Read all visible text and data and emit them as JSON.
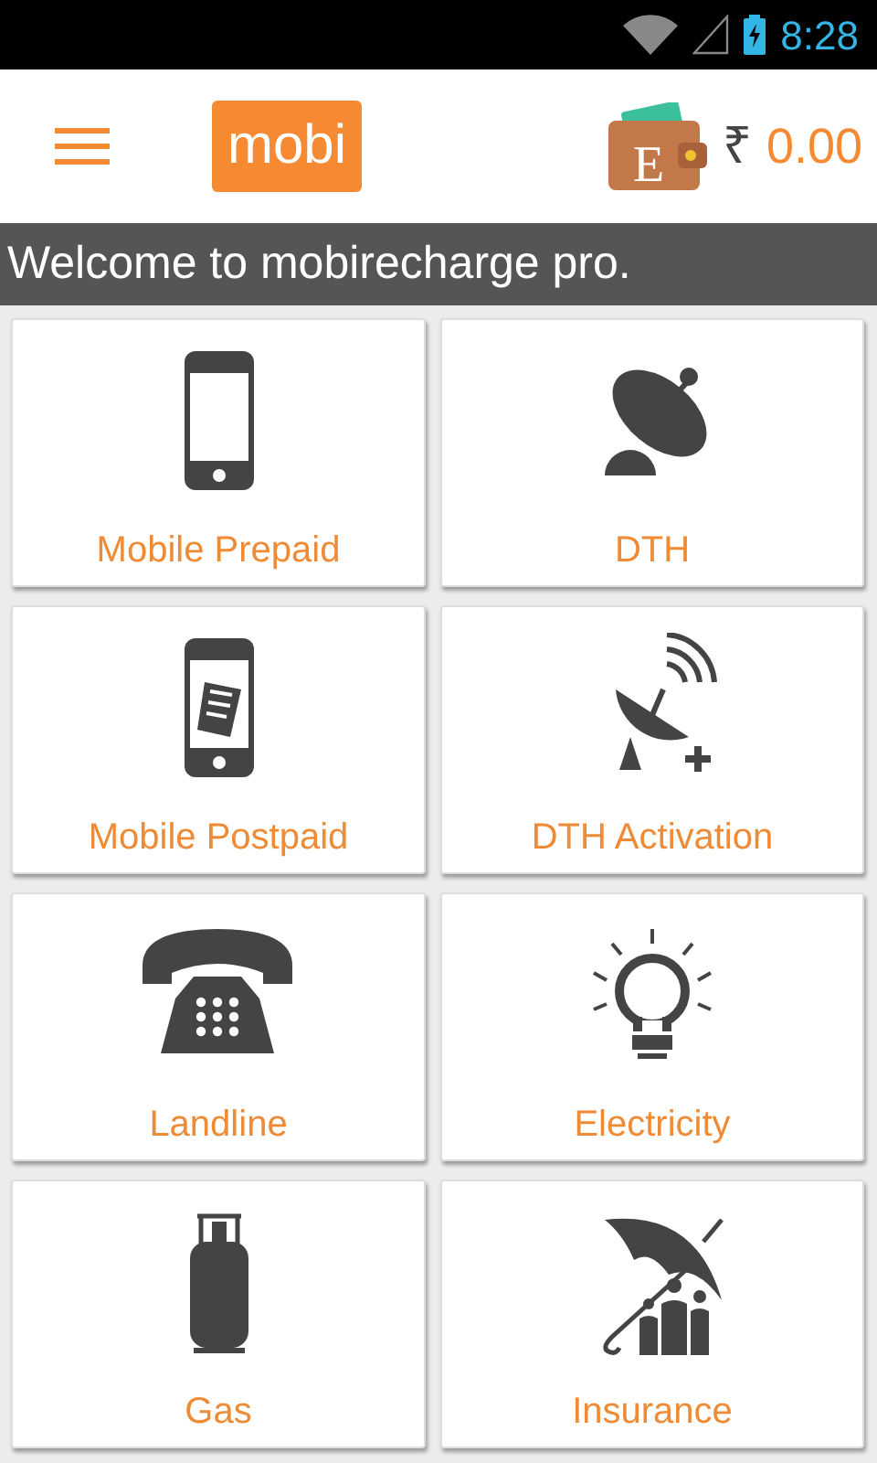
{
  "status_bar": {
    "time": "8:28"
  },
  "header": {
    "logo": "mobi",
    "wallet_letter": "E",
    "currency": "₹",
    "balance": "0.00"
  },
  "welcome": "Welcome to mobirecharge pro.",
  "services": [
    {
      "label": "Mobile Prepaid",
      "kind": "phone"
    },
    {
      "label": "DTH",
      "kind": "dish"
    },
    {
      "label": "Mobile Postpaid",
      "kind": "bill"
    },
    {
      "label": "DTH Activation",
      "kind": "dish-plus"
    },
    {
      "label": "Landline",
      "kind": "telephone"
    },
    {
      "label": "Electricity",
      "kind": "bulb"
    },
    {
      "label": "Gas",
      "kind": "cylinder"
    },
    {
      "label": "Insurance",
      "kind": "umbrella"
    }
  ]
}
